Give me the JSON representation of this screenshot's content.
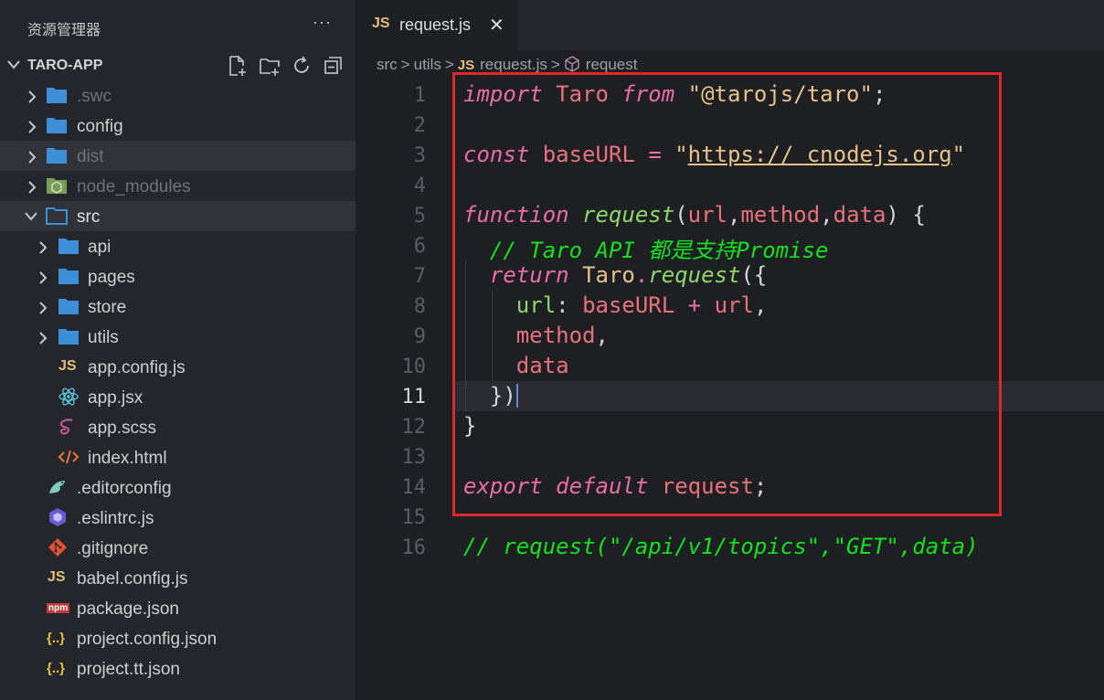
{
  "explorer": {
    "title": "资源管理器",
    "more": "···",
    "project_name": "TARO-APP"
  },
  "tree": [
    {
      "label": ".swc"
    },
    {
      "label": "config"
    },
    {
      "label": "dist"
    },
    {
      "label": "node_modules"
    },
    {
      "label": "src"
    },
    {
      "label": "api"
    },
    {
      "label": "pages"
    },
    {
      "label": "store"
    },
    {
      "label": "utils"
    },
    {
      "label": "app.config.js"
    },
    {
      "label": "app.jsx"
    },
    {
      "label": "app.scss"
    },
    {
      "label": "index.html"
    },
    {
      "label": ".editorconfig"
    },
    {
      "label": ".eslintrc.js"
    },
    {
      "label": ".gitignore"
    },
    {
      "label": "babel.config.js"
    },
    {
      "label": "package.json"
    },
    {
      "label": "project.config.json"
    },
    {
      "label": "project.tt.json"
    }
  ],
  "icons": {
    "js_badge": "JS",
    "json_badge": "{..}",
    "npm_badge": "npm"
  },
  "tab": {
    "badge": "JS",
    "name": "request.js",
    "close": "✕"
  },
  "breadcrumb": {
    "part1": "src",
    "part2": "utils",
    "file_badge": "JS",
    "file": "request.js",
    "symbol": "request",
    "sep": ">"
  },
  "code": {
    "line_numbers": [
      "1",
      "2",
      "3",
      "4",
      "5",
      "6",
      "7",
      "8",
      "9",
      "10",
      "11",
      "12",
      "13",
      "14",
      "15",
      "16"
    ],
    "l1": {
      "import": "import",
      "taro": "Taro",
      "from": "from",
      "str": "\"@tarojs/taro\"",
      "semi": ";"
    },
    "l3": {
      "const": "const",
      "name": "baseURL",
      "eq": "=",
      "q1": "\"",
      "url": "https:// cnodejs.org",
      "q2": "\""
    },
    "l5": {
      "function": "function",
      "name": "request",
      "p1": "(",
      "a1": "url",
      "c1": ",",
      "a2": "method",
      "c2": ",",
      "a3": "data",
      "p2": ") {"
    },
    "l6": {
      "comment": "// Taro API 都是支持Promise"
    },
    "l7": {
      "return": "return",
      "taro": "Taro",
      "dot": ".",
      "call": "request",
      "open": "({"
    },
    "l8": {
      "key": "url",
      "colon": ":",
      "base": "baseURL",
      "plus": "+",
      "url": "url",
      "comma": ","
    },
    "l9": {
      "key": "method",
      "comma": ","
    },
    "l10": {
      "key": "data"
    },
    "l11": {
      "close": "})"
    },
    "l12": {
      "brace": "}"
    },
    "l14": {
      "export": "export",
      "default": "default",
      "name": "request",
      "semi": ";"
    },
    "l16": {
      "comment": "// request(\"/api/v1/topics\",\"GET\",data)"
    }
  }
}
